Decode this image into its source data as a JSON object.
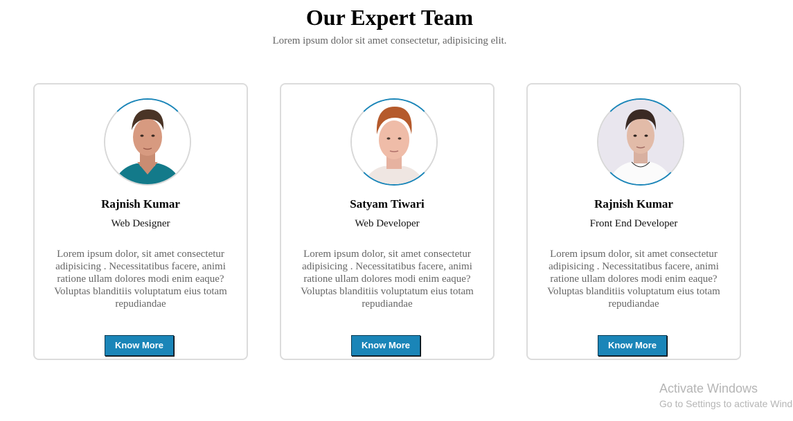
{
  "header": {
    "title": "Our Expert Team",
    "subtitle": "Lorem ipsum dolor sit amet consectetur, adipisicing elit."
  },
  "team": [
    {
      "name": "Rajnish Kumar",
      "role": "Web Designer",
      "description": "Lorem ipsum dolor, sit amet consectetur adipisicing . Necessitatibus facere, animi ratione ullam dolores modi enim eaque? Voluptas blanditiis voluptatum eius totam repudiandae",
      "button_label": "Know More"
    },
    {
      "name": "Satyam Tiwari",
      "role": "Web Developer",
      "description": "Lorem ipsum dolor, sit amet consectetur adipisicing . Necessitatibus facere, animi ratione ullam dolores modi enim eaque? Voluptas blanditiis voluptatum eius totam repudiandae",
      "button_label": "Know More"
    },
    {
      "name": "Rajnish Kumar",
      "role": "Front End Developer",
      "description": "Lorem ipsum dolor, sit amet consectetur adipisicing . Necessitatibus facere, animi ratione ullam dolores modi enim eaque? Voluptas blanditiis voluptatum eius totam repudiandae",
      "button_label": "Know More"
    }
  ],
  "watermark": {
    "line1": "Activate Windows",
    "line2": "Go to Settings to activate Windows."
  },
  "colors": {
    "accent": "#1a85b8",
    "card_border": "#dcdcdc",
    "muted_text": "#666666"
  }
}
